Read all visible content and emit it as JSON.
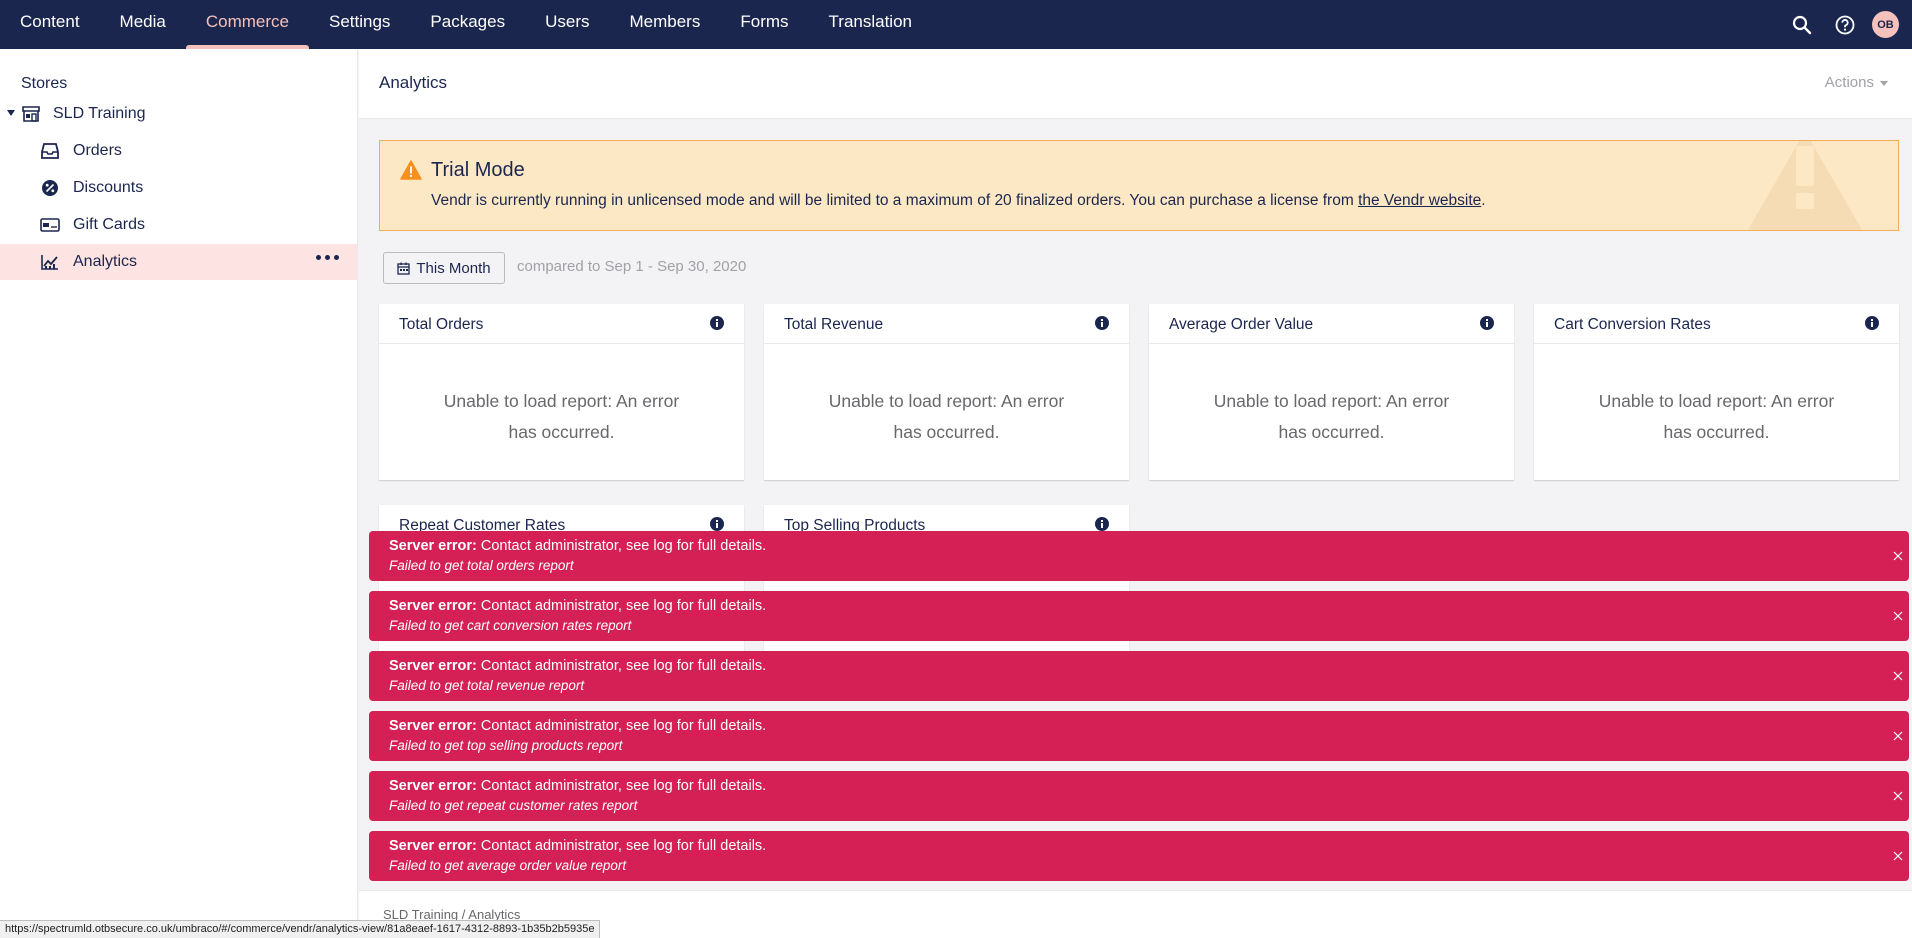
{
  "topnav": {
    "sections": [
      "Content",
      "Media",
      "Commerce",
      "Settings",
      "Packages",
      "Users",
      "Members",
      "Forms",
      "Translation"
    ],
    "active_section": "Commerce",
    "avatar_initials": "OB"
  },
  "tree": {
    "title": "Stores",
    "store": "SLD Training",
    "items": [
      "Orders",
      "Discounts",
      "Gift Cards",
      "Analytics"
    ],
    "active_item": "Analytics"
  },
  "header": {
    "title": "Analytics",
    "actions_label": "Actions"
  },
  "trial": {
    "title": "Trial Mode",
    "text_before": "Vendr is currently running in unlicensed mode and will be limited to a maximum of 20 finalized orders. You can purchase a license from ",
    "link": "the Vendr website",
    "text_after": "."
  },
  "filter": {
    "date_label": "This Month",
    "compare_text": "compared to Sep 1 - Sep 30, 2020"
  },
  "cards": [
    {
      "title": "Total Orders",
      "message": "Unable to load report: An error has occurred."
    },
    {
      "title": "Total Revenue",
      "message": "Unable to load report: An error has occurred."
    },
    {
      "title": "Average Order Value",
      "message": "Unable to load report: An error has occurred."
    },
    {
      "title": "Cart Conversion Rates",
      "message": "Unable to load report: An error has occurred."
    },
    {
      "title": "Repeat Customer Rates",
      "message": ""
    },
    {
      "title": "Top Selling Products",
      "message": ""
    }
  ],
  "notifications": [
    {
      "bold": "Server error:",
      "text": " Contact administrator, see log for full details.",
      "detail": "Failed to get total orders report"
    },
    {
      "bold": "Server error:",
      "text": " Contact administrator, see log for full details.",
      "detail": "Failed to get cart conversion rates report"
    },
    {
      "bold": "Server error:",
      "text": " Contact administrator, see log for full details.",
      "detail": "Failed to get total revenue report"
    },
    {
      "bold": "Server error:",
      "text": " Contact administrator, see log for full details.",
      "detail": "Failed to get top selling products report"
    },
    {
      "bold": "Server error:",
      "text": " Contact administrator, see log for full details.",
      "detail": "Failed to get repeat customer rates report"
    },
    {
      "bold": "Server error:",
      "text": " Contact administrator, see log for full details.",
      "detail": "Failed to get average order value report"
    }
  ],
  "footer": {
    "breadcrumb": [
      "SLD Training",
      "Analytics"
    ]
  },
  "status_url": "https://spectrumld.otbsecure.co.uk/umbraco/#/commerce/vendr/analytics-view/81a8eaef-1617-4312-8893-1b35b2b5935e",
  "colors": {
    "nav_bg": "#1b264f",
    "accent": "#f5c1bc",
    "error": "#d42054",
    "warning_bg": "#fde8c6"
  }
}
